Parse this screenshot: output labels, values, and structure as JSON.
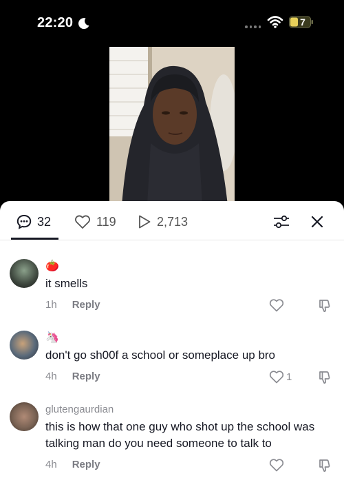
{
  "status_bar": {
    "time": "22:20",
    "battery": "7"
  },
  "tabs": {
    "comments_count": "32",
    "likes_count": "119",
    "views_count": "2,713"
  },
  "comments": [
    {
      "username": "",
      "emoji": "🍅",
      "text": "it smells",
      "time": "1h",
      "reply_label": "Reply",
      "like_count": ""
    },
    {
      "username": "",
      "emoji": "🦄",
      "text": "don't go sh00f a school or someplace up bro",
      "time": "4h",
      "reply_label": "Reply",
      "like_count": "1"
    },
    {
      "username": "glutengaurdian",
      "emoji": "",
      "text": "this is how that one guy who shot up the school was talking man do you need someone to talk to",
      "time": "4h",
      "reply_label": "Reply",
      "like_count": ""
    }
  ]
}
